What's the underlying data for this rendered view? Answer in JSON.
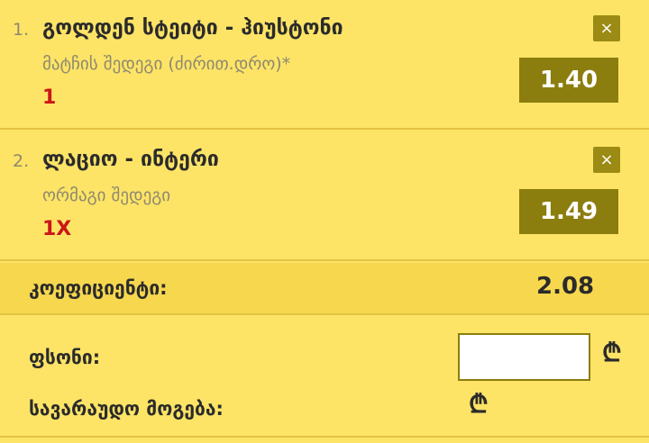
{
  "bets": [
    {
      "index": "1.",
      "match": "გოლდენ სტეიტი - ჰიუსტონი",
      "market": "მატჩის შედეგი (ძირით.დრო)*",
      "pick": "1",
      "odd": "1.40",
      "remove_symbol": "×"
    },
    {
      "index": "2.",
      "match": "ლაციო - ინტერი",
      "market": "ორმაგი შედეგი",
      "pick": "1X",
      "odd": "1.49",
      "remove_symbol": "×"
    }
  ],
  "summary": {
    "coef_label": "კოეფიციენტი:",
    "coef_value": "2.08",
    "stake_label": "ფსონი:",
    "stake_value": "",
    "currency_symbol": "₾",
    "win_label": "სავარაუდო მოგება:",
    "win_value": "",
    "win_currency_symbol": "₾"
  },
  "colors": {
    "background": "#fde466",
    "odd_button": "#8c7d0f",
    "remove_button": "#9b8a13",
    "pick_red": "#cc1717",
    "muted_text": "#8e8870"
  },
  "icons": {
    "remove": "close-icon",
    "currency": "lari-icon"
  }
}
